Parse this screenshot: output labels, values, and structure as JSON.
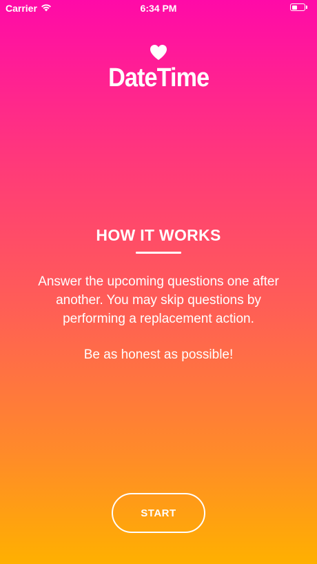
{
  "status_bar": {
    "carrier": "Carrier",
    "time": "6:34 PM",
    "icons": [
      "wifi-icon",
      "battery-icon"
    ]
  },
  "logo": {
    "icon": "heart-icon",
    "title": "DateTime"
  },
  "how_it_works": {
    "heading": "HOW IT WORKS",
    "body": "Answer the upcoming questions one after another. You may skip questions by performing a replacement action.",
    "note": "Be as honest as possible!"
  },
  "actions": {
    "start_label": "START"
  },
  "colors": {
    "gradient_top": "#ff0aa8",
    "gradient_bottom": "#ffb000",
    "foreground": "#ffffff"
  }
}
